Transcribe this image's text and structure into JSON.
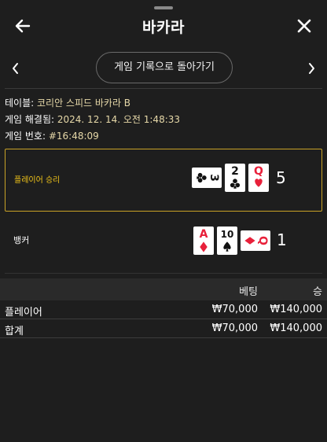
{
  "header": {
    "title": "바카라"
  },
  "nav": {
    "history_button": "게임 기록으로 돌아가기"
  },
  "info": {
    "table_label": "테이블:",
    "table_value": "코리안 스피드 바카라 B",
    "resolved_label": "게임 해결됨:",
    "resolved_value": "2024. 12. 14. 오전 1:48:33",
    "game_no_label": "게임 번호:",
    "game_no_value": "#16:48:09"
  },
  "player": {
    "label": "플레이어 승리",
    "score": "5",
    "cards": [
      {
        "rank": "3",
        "suit": "clubs",
        "rotated": true
      },
      {
        "rank": "2",
        "suit": "clubs",
        "rotated": false
      },
      {
        "rank": "Q",
        "suit": "hearts",
        "rotated": false
      }
    ]
  },
  "banker": {
    "label": "뱅커",
    "score": "1",
    "cards": [
      {
        "rank": "A",
        "suit": "diamonds",
        "rotated": false
      },
      {
        "rank": "10",
        "suit": "spades",
        "rotated": false
      },
      {
        "rank": "Q",
        "suit": "diamonds",
        "rotated": true
      }
    ]
  },
  "bets_table": {
    "headers": {
      "bet": "베팅",
      "win": "승"
    },
    "rows": [
      {
        "name": "플레이어",
        "bet": "₩70,000",
        "win": "₩140,000"
      }
    ],
    "total": {
      "name": "합계",
      "bet": "₩70,000",
      "win": "₩140,000"
    }
  },
  "colors": {
    "background": "#1e1e1e",
    "accent_gold": "#c9a227",
    "winner_text": "#f0c419",
    "info_value": "#e6d8a8",
    "card_red": "#e8203a",
    "card_black": "#111111"
  },
  "icons": {
    "back": "arrow-left-icon",
    "close": "close-icon",
    "prev": "chevron-left-icon",
    "next": "chevron-right-icon"
  }
}
